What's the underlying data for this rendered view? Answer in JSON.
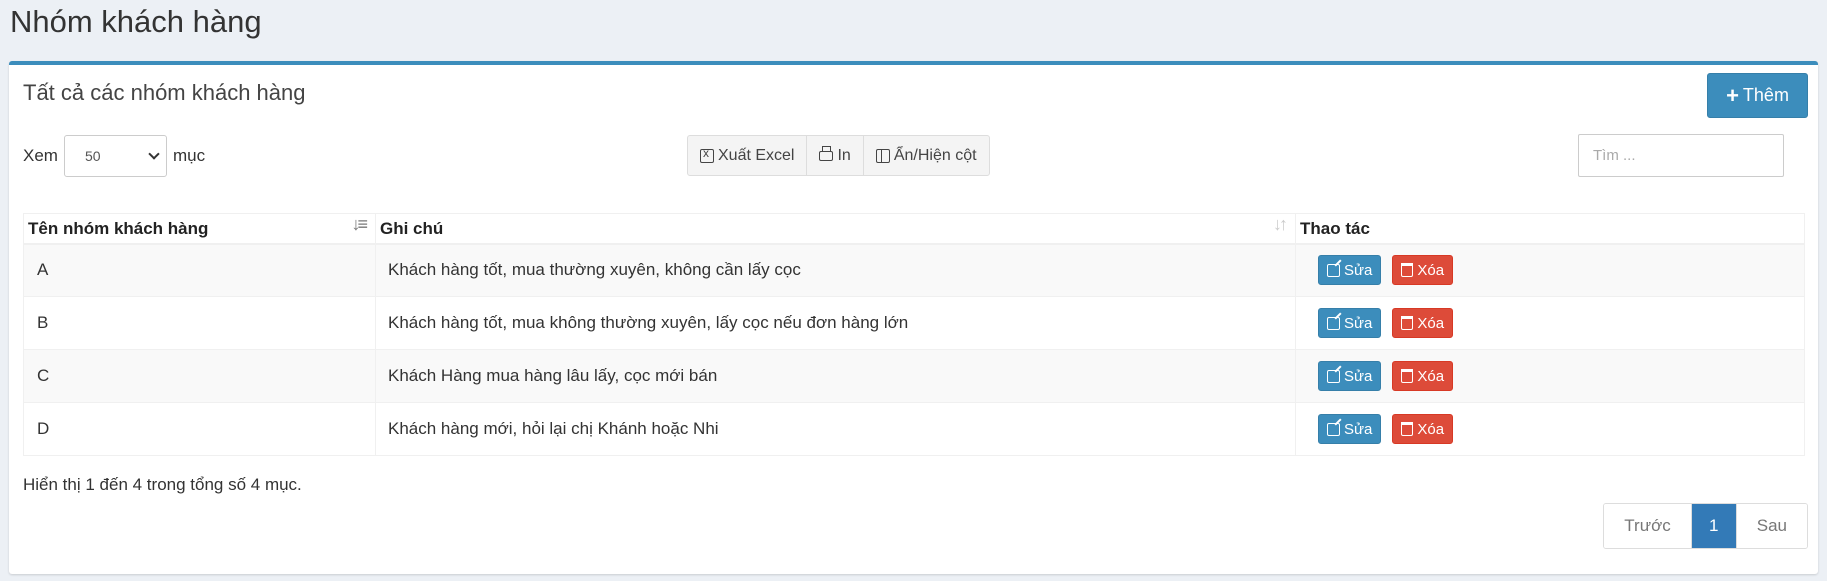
{
  "page": {
    "title": "Nhóm khách hàng"
  },
  "box": {
    "title": "Tất cả các nhóm khách hàng",
    "add_label": "Thêm"
  },
  "length": {
    "prefix": "Xem",
    "value": "50",
    "suffix": "mục"
  },
  "toolbar": {
    "excel_label": "Xuất Excel",
    "print_label": "In",
    "columns_label": "Ẩn/Hiện cột"
  },
  "search": {
    "placeholder": "Tìm ..."
  },
  "table": {
    "headers": {
      "name": "Tên nhóm khách hàng",
      "note": "Ghi chú",
      "actions": "Thao tác"
    },
    "rows": [
      {
        "name": "A",
        "note": "Khách hàng tốt, mua thường xuyên, không cần lấy cọc",
        "edit": "Sửa",
        "delete": "Xóa"
      },
      {
        "name": "B",
        "note": "Khách hàng tốt, mua không thường xuyên, lấy cọc nếu đơn hàng lớn",
        "edit": "Sửa",
        "delete": "Xóa"
      },
      {
        "name": "C",
        "note": "Khách Hàng mua hàng lâu lấy, cọc mới bán",
        "edit": "Sửa",
        "delete": "Xóa"
      },
      {
        "name": "D",
        "note": "Khách hàng mới, hỏi lại chị Khánh hoặc Nhi",
        "edit": "Sửa",
        "delete": "Xóa"
      }
    ]
  },
  "info": {
    "text": "Hiển thị 1 đến 4 trong tổng số 4 mục."
  },
  "pagination": {
    "prev": "Trước",
    "current": "1",
    "next": "Sau"
  },
  "colors": {
    "primary": "#3c8dbc",
    "danger": "#dd4b39",
    "page_bg": "#ecf0f5"
  }
}
